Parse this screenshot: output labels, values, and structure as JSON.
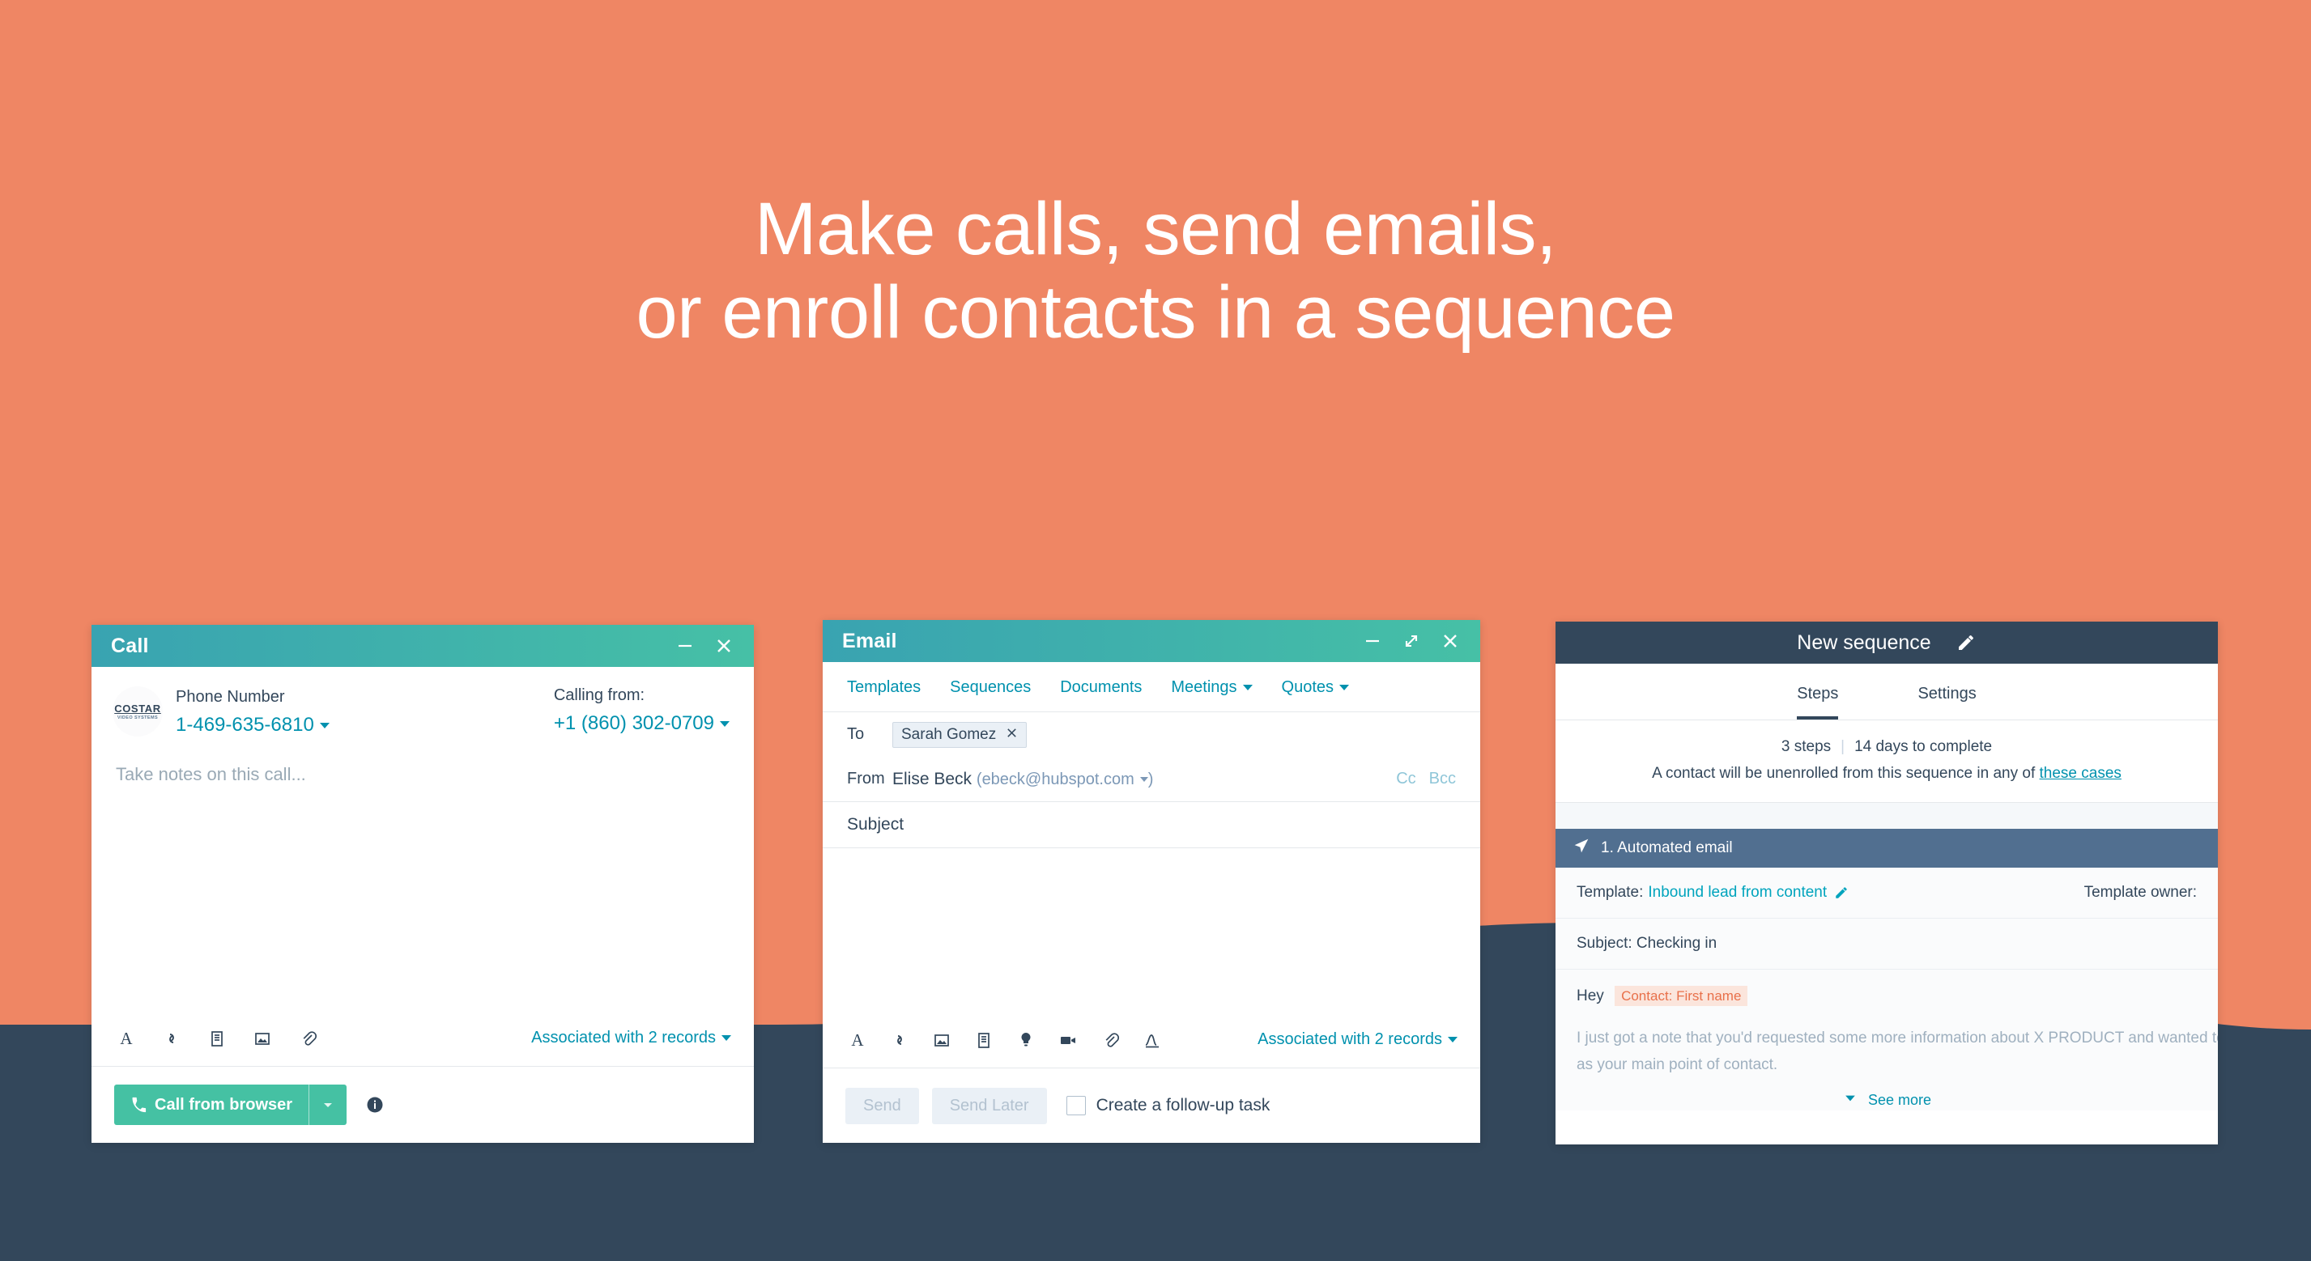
{
  "page": {
    "headline_line1": "Make calls, send emails,",
    "headline_line2": "or enroll contacts in a sequence",
    "bg_color": "#ef8664",
    "navy_color": "#33475b"
  },
  "call_window": {
    "title": "Call",
    "minimize_label": "–",
    "close_label": "×",
    "logo_line1": "COSTAR",
    "logo_line2": "VIDEO SYSTEMS",
    "phone_label": "Phone Number",
    "phone_value": "1-469-635-6810",
    "calling_from_label": "Calling from:",
    "calling_from_value": "+1 (860) 302-0709",
    "notes_placeholder": "Take notes on this call...",
    "associated_label": "Associated with 2 records",
    "call_button_label": "Call from browser",
    "toolbar_icons": [
      "font-icon",
      "link-icon",
      "document-icon",
      "image-icon",
      "attachment-icon"
    ]
  },
  "email_window": {
    "title": "Email",
    "minimize_label": "–",
    "expand_label": "expand-icon",
    "close_label": "×",
    "tabs": [
      "Templates",
      "Sequences",
      "Documents",
      "Meetings",
      "Quotes"
    ],
    "tabs_with_caret": [
      "Meetings",
      "Quotes"
    ],
    "to_label": "To",
    "to_chip": "Sarah Gomez",
    "from_label": "From",
    "from_name": "Elise Beck",
    "from_email": "ebeck@hubspot.com",
    "cc_label": "Cc",
    "bcc_label": "Bcc",
    "subject_label": "Subject",
    "associated_label": "Associated with 2 records",
    "send_label": "Send",
    "send_later_label": "Send Later",
    "followup_label": "Create a follow-up task",
    "toolbar_icons": [
      "font-icon",
      "link-icon",
      "image-icon",
      "document-icon",
      "knowledge-icon",
      "video-icon",
      "attachment-icon",
      "signature-icon"
    ]
  },
  "sequence_window": {
    "title": "New sequence",
    "edit_icon": "pencil-icon",
    "tabs": [
      "Steps",
      "Settings"
    ],
    "active_tab": "Steps",
    "steps_count": "3 steps",
    "divider": "|",
    "days_to_complete": "14 days to complete",
    "unenroll_text": "A contact will be unenrolled from this sequence in any of",
    "unenroll_link": "these cases",
    "step_title": "1. Automated email",
    "template_label": "Template:",
    "template_name": "Inbound lead from content",
    "template_owner_label": "Template owner:",
    "subject_line": "Subject: Checking in",
    "greeting": "Hey",
    "token": "Contact: First name",
    "body_line1": "I just got a note that you'd requested some more information about X PRODUCT and wanted to introdu",
    "body_line2": "as your main point of contact.",
    "see_more_label": "See more"
  }
}
